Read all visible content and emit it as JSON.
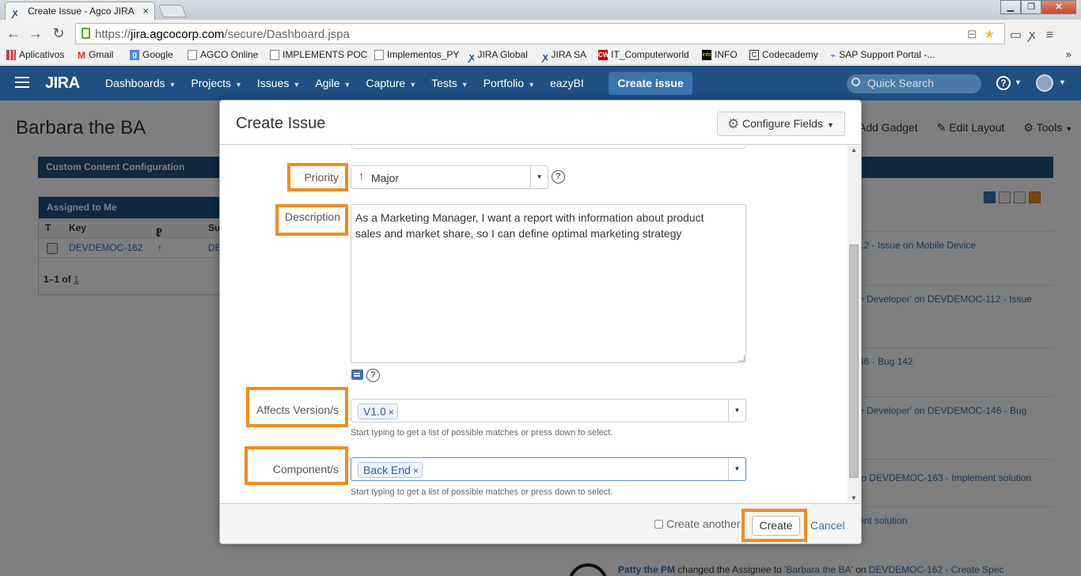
{
  "browser": {
    "tab_title": "Create Issue - Agco JIRA",
    "tab_close": "×",
    "url_prefix": "https://",
    "url_host": "jira.agcocorp.com",
    "url_path": "/secure/Dashboard.jspa",
    "window_buttons": [
      "▁",
      "❐",
      "✕"
    ]
  },
  "bookmarks": [
    {
      "label": "Aplicativos",
      "icon": "apps-icon"
    },
    {
      "label": "Gmail",
      "icon": "gmail-icon",
      "glyph": "M"
    },
    {
      "label": "Google",
      "icon": "google-icon",
      "glyph": "g"
    },
    {
      "label": "AGCO Online",
      "icon": "page-icon"
    },
    {
      "label": "IMPLEMENTS POC",
      "icon": "page-icon"
    },
    {
      "label": "Implementos_PY",
      "icon": "page-icon"
    },
    {
      "label": "JIRA Global",
      "icon": "jira-icon"
    },
    {
      "label": "JIRA SA",
      "icon": "jira-icon"
    },
    {
      "label": "IT_Computerworld",
      "icon": "computerworld-icon",
      "glyph": "CW"
    },
    {
      "label": "INFO",
      "icon": "info-icon",
      "glyph": "info"
    },
    {
      "label": "Codecademy",
      "icon": "codecademy-icon",
      "glyph": "C"
    },
    {
      "label": "SAP Support Portal -...",
      "icon": "sap-icon"
    }
  ],
  "bookmarks_more": "»",
  "jira": {
    "logo": "JIRA",
    "nav": [
      "Dashboards",
      "Projects",
      "Issues",
      "Agile",
      "Capture",
      "Tests",
      "Portfolio",
      "eazyBI"
    ],
    "create_issue": "Create issue",
    "quick_search_placeholder": "Quick Search",
    "help": "?"
  },
  "dashboard": {
    "title": "Barbara the BA",
    "tools": [
      "Add Gadget",
      "Edit Layout",
      "Tools"
    ],
    "gadget_header": "Custom Content Configuration",
    "assigned": {
      "header": "Assigned to Me",
      "columns": [
        "T",
        "Key",
        "P",
        "Su"
      ],
      "row": {
        "key": "DEVDEMOC-162",
        "summary": "DE"
      },
      "footer_prefix": "1–1 of ",
      "footer_link": "1"
    },
    "stream": [
      "12 - Issue on Mobile Device",
      "e Developer' on DEVDEMOC-112 - Issue",
      "46 - Bug 142",
      "e Developer' on DEVDEMOC-146 - Bug",
      "to DEVDEMOC-163 - Implement solution",
      "ent solution"
    ],
    "last_entry": {
      "user": "Patty the PM",
      "action": " changed the Assignee to ",
      "target": "'Barbara the BA'",
      "on": " on ",
      "issue": "DEVDEMOC-162 - Create Spec"
    }
  },
  "dialog": {
    "title": "Create Issue",
    "configure_fields": "Configure Fields",
    "priority": {
      "label": "Priority",
      "value": "Major"
    },
    "description": {
      "label": "Description",
      "line1": "As a Marketing Manager, I want a report with information about product",
      "line2": "sales and market share, so I can define optimal marketing strategy"
    },
    "affects_version": {
      "label": "Affects Version/s",
      "chip": "V1.0",
      "hint": "Start typing to get a list of possible matches or press down to select."
    },
    "component": {
      "label": "Component/s",
      "chip": "Back End",
      "hint": "Start typing to get a list of possible matches or press down to select."
    },
    "create_another": "Create another",
    "create": "Create",
    "cancel": "Cancel"
  },
  "colors": {
    "jira_blue": "#205081",
    "highlight_orange": "#f28c1b",
    "link_blue": "#3b73af"
  }
}
